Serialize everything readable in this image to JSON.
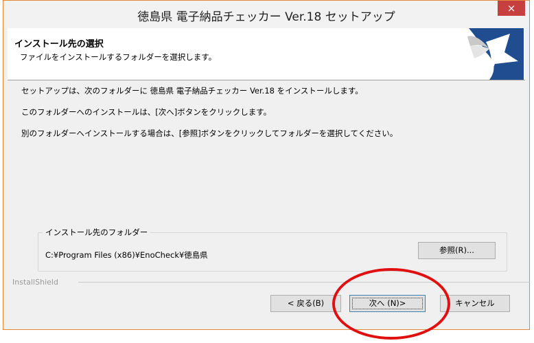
{
  "window": {
    "title": "徳島県 電子納品チェッカー Ver.18 セットアップ",
    "close_icon": "×"
  },
  "header": {
    "title": "インストール先の選択",
    "subtitle": "ファイルをインストールするフォルダーを選択します。"
  },
  "body": {
    "lines": [
      "セットアップは、次のフォルダーに 徳島県 電子納品チェッカー Ver.18 をインストールします。",
      "このフォルダーへのインストールは、[次へ]ボタンをクリックします。",
      "別のフォルダーへインストールする場合は、[参照]ボタンをクリックしてフォルダーを選択してください。"
    ]
  },
  "destination": {
    "group_label": "インストール先のフォルダー",
    "path": "C:¥Program Files (x86)¥EnoCheck¥徳島県",
    "browse_label": "参照(R)..."
  },
  "footer": {
    "brand": "InstallShield",
    "back_label": "< 戻る(B)",
    "next_label": "次へ (N)>",
    "cancel_label": "キャンセル"
  },
  "colors": {
    "close_button": "#c7403f",
    "annotation": "#e01010",
    "window_border": "#e3873c"
  }
}
